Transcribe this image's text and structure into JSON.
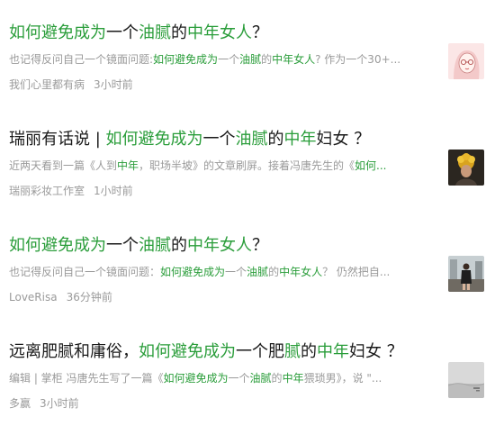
{
  "articles": [
    {
      "title": [
        {
          "t": "如何避免成为",
          "hl": true
        },
        {
          "t": "一个",
          "hl": false
        },
        {
          "t": "油腻",
          "hl": true
        },
        {
          "t": "的",
          "hl": false
        },
        {
          "t": "中年女人",
          "hl": true
        },
        {
          "t": "？",
          "hl": false
        }
      ],
      "summary": [
        {
          "t": "也记得反问自己一个镜面问题:",
          "hl": false
        },
        {
          "t": "如何避免成为",
          "hl": true
        },
        {
          "t": "一个",
          "hl": false
        },
        {
          "t": "油腻",
          "hl": true
        },
        {
          "t": "的",
          "hl": false
        },
        {
          "t": "中年女人",
          "hl": true
        },
        {
          "t": "? 作为一个30+...",
          "hl": false
        }
      ],
      "source": "我们心里都有病",
      "time": "3小时前",
      "thumb_icon": "illustrated-woman-portrait-thumbnail"
    },
    {
      "title": [
        {
          "t": "瑞丽有话说 | ",
          "hl": false
        },
        {
          "t": "如何避免成为",
          "hl": true
        },
        {
          "t": "一个",
          "hl": false
        },
        {
          "t": "油腻",
          "hl": true
        },
        {
          "t": "的",
          "hl": false
        },
        {
          "t": "中年",
          "hl": true
        },
        {
          "t": "妇女 ？",
          "hl": false
        }
      ],
      "summary": [
        {
          "t": "近两天看到一篇《人到",
          "hl": false
        },
        {
          "t": "中年",
          "hl": true
        },
        {
          "t": "，职场半坡》的文章刷屏。接着冯唐先生的《",
          "hl": false
        },
        {
          "t": "如何...",
          "hl": true
        }
      ],
      "source": "瑞丽彩妆工作室",
      "time": "1小时前",
      "thumb_icon": "flower-woman-photo-thumbnail"
    },
    {
      "title": [
        {
          "t": "如何避免成为",
          "hl": true
        },
        {
          "t": "一个",
          "hl": false
        },
        {
          "t": "油腻",
          "hl": true
        },
        {
          "t": "的",
          "hl": false
        },
        {
          "t": "中年女人",
          "hl": true
        },
        {
          "t": "？",
          "hl": false
        }
      ],
      "summary": [
        {
          "t": "也记得反问自己一个镜面问题：",
          "hl": false
        },
        {
          "t": "如何避免成为",
          "hl": true
        },
        {
          "t": "一个",
          "hl": false
        },
        {
          "t": "油腻",
          "hl": true
        },
        {
          "t": "的",
          "hl": false
        },
        {
          "t": "中年女人",
          "hl": true
        },
        {
          "t": "？ 仍然把自...",
          "hl": false
        }
      ],
      "source": "LoveRisa",
      "time": "36分钟前",
      "thumb_icon": "street-woman-photo-thumbnail"
    },
    {
      "title": [
        {
          "t": "远离肥腻和庸俗，",
          "hl": false
        },
        {
          "t": "如何避免成为",
          "hl": true
        },
        {
          "t": "一个肥",
          "hl": false
        },
        {
          "t": "腻",
          "hl": true
        },
        {
          "t": "的",
          "hl": false
        },
        {
          "t": "中年",
          "hl": true
        },
        {
          "t": "妇女 ？",
          "hl": false
        }
      ],
      "summary": [
        {
          "t": "编辑 | 掌柜 冯唐先生写了一篇《",
          "hl": false
        },
        {
          "t": "如何避免成为",
          "hl": true
        },
        {
          "t": "一个",
          "hl": false
        },
        {
          "t": "油腻",
          "hl": true
        },
        {
          "t": "的",
          "hl": false
        },
        {
          "t": "中年",
          "hl": true
        },
        {
          "t": "猥琐男》，说 \"...",
          "hl": false
        }
      ],
      "source": "多赢",
      "time": "3小时前",
      "thumb_icon": "grey-landscape-thumbnail"
    }
  ],
  "colors": {
    "highlight": "#2a9d3a",
    "meta": "#9a9a9a",
    "title": "#1a1a1a"
  }
}
